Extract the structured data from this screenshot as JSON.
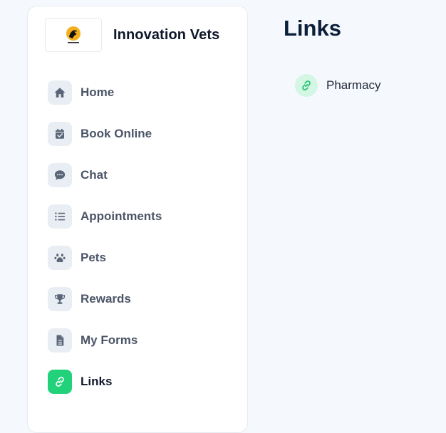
{
  "brand": {
    "name": "Innovation Vets",
    "logo_icon": "innovation-vets-logo"
  },
  "sidebar": {
    "items": [
      {
        "label": "Home",
        "icon": "home-icon"
      },
      {
        "label": "Book Online",
        "icon": "calendar-check-icon"
      },
      {
        "label": "Chat",
        "icon": "chat-bubble-icon"
      },
      {
        "label": "Appointments",
        "icon": "list-icon"
      },
      {
        "label": "Pets",
        "icon": "paw-icon"
      },
      {
        "label": "Rewards",
        "icon": "trophy-icon"
      },
      {
        "label": "My Forms",
        "icon": "document-icon"
      },
      {
        "label": "Links",
        "icon": "link-icon",
        "active": true
      }
    ]
  },
  "main": {
    "title": "Links",
    "links": [
      {
        "label": "Pharmacy",
        "icon": "link-icon"
      }
    ]
  },
  "colors": {
    "accent": "#22d27a",
    "accent_soft": "#d4f6e4",
    "icon_bg": "#e9eef4",
    "icon_fg": "#5b6578",
    "title": "#0b1f3a"
  }
}
